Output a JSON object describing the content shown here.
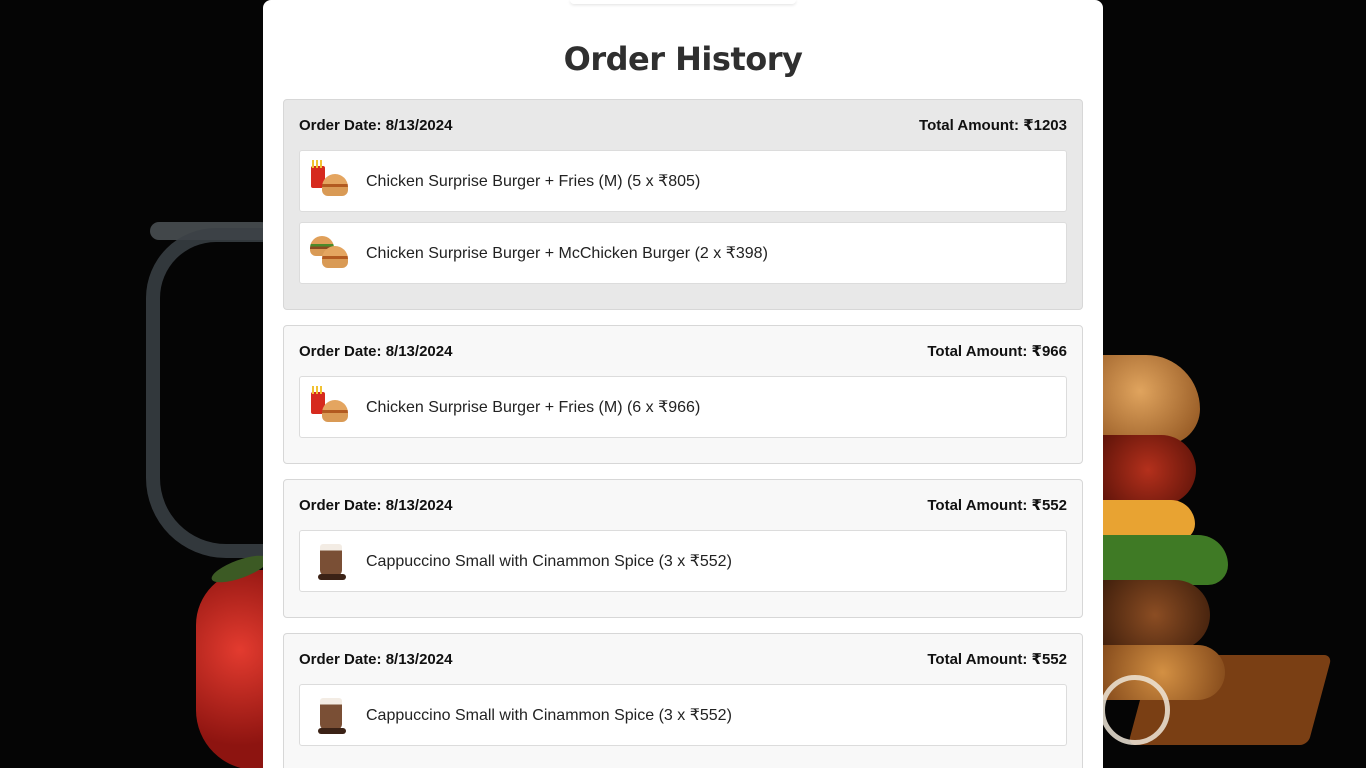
{
  "page": {
    "title": "Order History"
  },
  "labels": {
    "order_date": "Order Date:",
    "total_amount": "Total Amount:"
  },
  "orders": [
    {
      "date": "8/13/2024",
      "total": "₹1203",
      "items": [
        {
          "icon": "burger-fries-thumb",
          "name": "Chicken Surprise Burger + Fries (M) (5 x ₹805)"
        },
        {
          "icon": "two-burgers-thumb",
          "name": "Chicken Surprise Burger + McChicken Burger (2 x ₹398)"
        }
      ]
    },
    {
      "date": "8/13/2024",
      "total": "₹966",
      "items": [
        {
          "icon": "burger-fries-thumb",
          "name": "Chicken Surprise Burger + Fries (M) (6 x ₹966)"
        }
      ]
    },
    {
      "date": "8/13/2024",
      "total": "₹552",
      "items": [
        {
          "icon": "cappuccino-thumb",
          "name": "Cappuccino Small with Cinammon Spice (3 x ₹552)"
        }
      ]
    },
    {
      "date": "8/13/2024",
      "total": "₹552",
      "items": [
        {
          "icon": "cappuccino-thumb",
          "name": "Cappuccino Small with Cinammon Spice (3 x ₹552)"
        }
      ]
    }
  ],
  "colors": {
    "page_bg": "#050505",
    "card_bg": "#f8f8f8",
    "highlight_bg": "#e8e8e8",
    "panel_bg": "#ffffff"
  }
}
